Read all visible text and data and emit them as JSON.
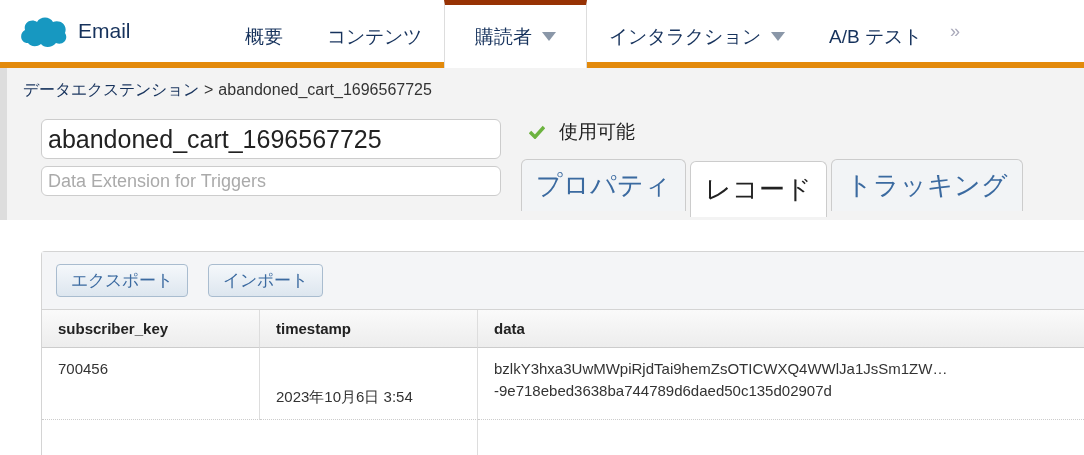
{
  "app": {
    "name": "Email"
  },
  "nav": [
    {
      "label": "概要",
      "selected": false,
      "dropdown": false
    },
    {
      "label": "コンテンツ",
      "selected": false,
      "dropdown": false
    },
    {
      "label": "購読者",
      "selected": true,
      "dropdown": true
    },
    {
      "label": "インタラクション",
      "selected": false,
      "dropdown": true
    },
    {
      "label": "A/B テスト",
      "selected": false,
      "dropdown": false
    }
  ],
  "nav_more": "»",
  "breadcrumb": {
    "link": "データエクステンション",
    "separator": ">",
    "current": "abandoned_cart_1696567725"
  },
  "name_field": {
    "value": "abandoned_cart_1696567725"
  },
  "description_field": {
    "placeholder": "Data Extension for Triggers"
  },
  "status": {
    "label": "使用可能",
    "ok": true
  },
  "tabs": [
    {
      "label": "プロパティ",
      "selected": false
    },
    {
      "label": "レコード",
      "selected": true
    },
    {
      "label": "トラッキング",
      "selected": false
    }
  ],
  "buttons": [
    "エクスポート",
    "インポート"
  ],
  "table": {
    "columns": [
      "subscriber_key",
      "timestamp",
      "data"
    ],
    "rows": [
      {
        "cells": [
          "700456",
          "2023年10月6日 3:54"
        ],
        "data_lines": [
          "bzlkY3hxa3UwMWpiRjdTai9hemZsOTICWXQ4WWlJa1JsSm1ZW…",
          "-9e718ebed3638ba744789d6daed50c135d02907d"
        ]
      }
    ]
  }
}
